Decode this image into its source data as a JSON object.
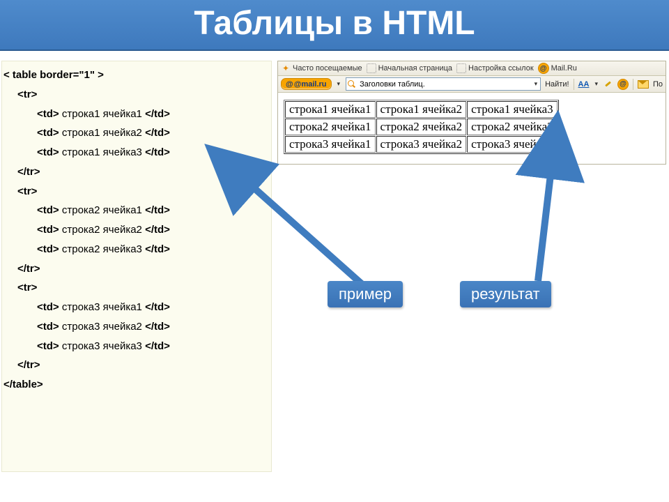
{
  "title": "Таблицы в HTML",
  "code": {
    "open_table": "< table border=\"1\" >",
    "tr_open": "<tr>",
    "tr_close": "</tr>",
    "td_open": "<td>",
    "td_close": "</td>",
    "close_table": "</table>",
    "cells": {
      "r1c1": "строка1 ячейка1",
      "r1c2": "строка1 ячейка2",
      "r1c3": "строка1 ячейка3",
      "r2c1": "строка2 ячейка1",
      "r2c2": "строка2 ячейка2",
      "r2c3": "строка2 ячейка3",
      "r3c1": "строка3 ячейка1",
      "r3c2": "строка3 ячейка2",
      "r3c3": "строка3 ячейка3"
    }
  },
  "browser": {
    "bookmarks": {
      "frequent": "Часто посещаемые",
      "start": "Начальная страница",
      "links": "Настройка ссылок",
      "mailru": "Mail.Ru"
    },
    "logo": "@mail.ru",
    "search_value": "Заголовки таблиц.",
    "find_btn": "Найти!",
    "aa": "AA",
    "more": "По"
  },
  "result_table": [
    [
      "строка1 ячейка1",
      "строка1 ячейка2",
      "строка1 ячейка3"
    ],
    [
      "строка2 ячейка1",
      "строка2 ячейка2",
      "строка2 ячейка3"
    ],
    [
      "строка3 ячейка1",
      "строка3 ячейка2",
      "строка3 ячейка3"
    ]
  ],
  "callouts": {
    "example": "пример",
    "result": "результат"
  }
}
